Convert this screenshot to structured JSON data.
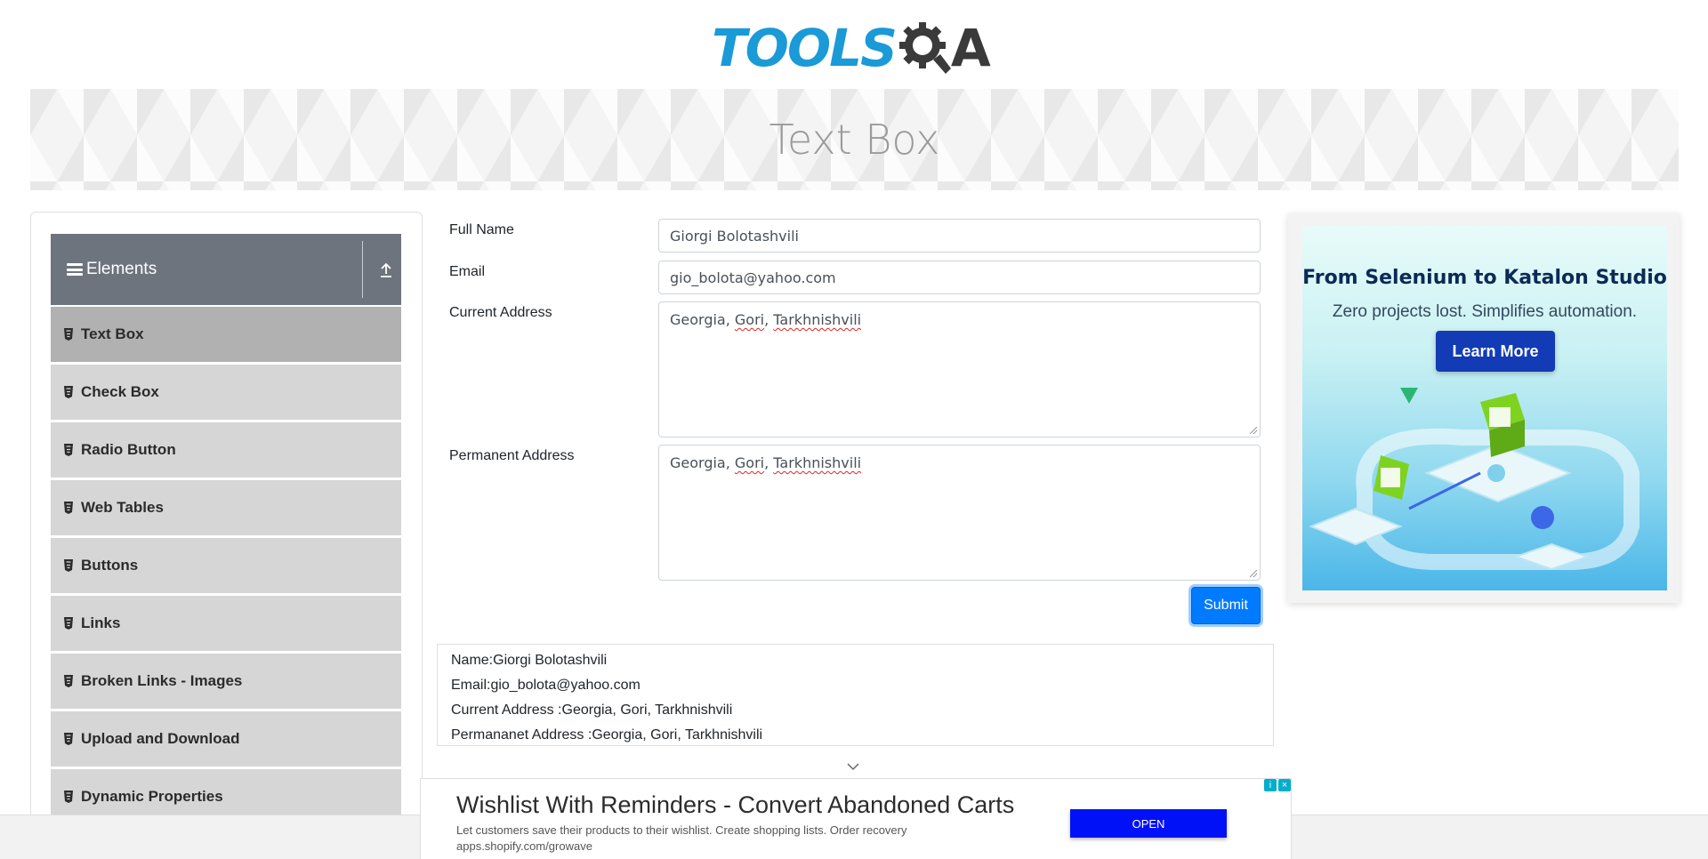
{
  "header": {
    "logo_part1": "TOOLS",
    "logo_part2": "A",
    "logo_icon": "magnifier-gear-icon"
  },
  "banner": {
    "title": "Text Box"
  },
  "sidebar": {
    "group_title": "Elements",
    "group_icon": "hamburger-icon",
    "collapse_icon": "upload-arrow-icon",
    "items": [
      {
        "label": "Text Box",
        "active": true
      },
      {
        "label": "Check Box"
      },
      {
        "label": "Radio Button"
      },
      {
        "label": "Web Tables"
      },
      {
        "label": "Buttons"
      },
      {
        "label": "Links"
      },
      {
        "label": "Broken Links - Images"
      },
      {
        "label": "Upload and Download"
      },
      {
        "label": "Dynamic Properties"
      }
    ]
  },
  "form": {
    "full_name_label": "Full Name",
    "full_name_value": "Giorgi Bolotashvili",
    "email_label": "Email",
    "email_value": "gio_bolota@yahoo.com",
    "current_address_label": "Current Address",
    "current_address_value": {
      "p1": "Georgia, ",
      "p2": "Gori",
      "p3": ", ",
      "p4": "Tarkhnishvili"
    },
    "permanent_address_label": "Permanent Address",
    "permanent_address_value": {
      "p1": "Georgia, ",
      "p2": "Gori",
      "p3": ", ",
      "p4": "Tarkhnishvili"
    },
    "submit_label": "Submit"
  },
  "output": {
    "name": "Name:Giorgi Bolotashvili",
    "email": "Email:gio_bolota@yahoo.com",
    "current_address": "Current Address :Georgia, Gori, Tarkhnishvili",
    "permanent_address": "Permananet Address :Georgia, Gori, Tarkhnishvili"
  },
  "right_ad": {
    "heading": "From Selenium to Katalon Studio",
    "subheading": "Zero projects lost. Simplifies automation.",
    "button": "Learn More"
  },
  "bottom_ad": {
    "title": "Wishlist With Reminders - Convert Abandoned Carts",
    "description": "Let customers save their products to their wishlist. Create shopping lists. Order recovery",
    "url": "apps.shopify.com/growave",
    "button": "OPEN"
  },
  "colors": {
    "accent": "#007bff",
    "sidebar_header": "#6d747d",
    "menu_item": "#d6d6d6",
    "menu_item_active": "#b1b1b1",
    "logo_blue": "#1a9ad6",
    "ad_button": "#123bb5",
    "open_button": "#0010f7"
  }
}
